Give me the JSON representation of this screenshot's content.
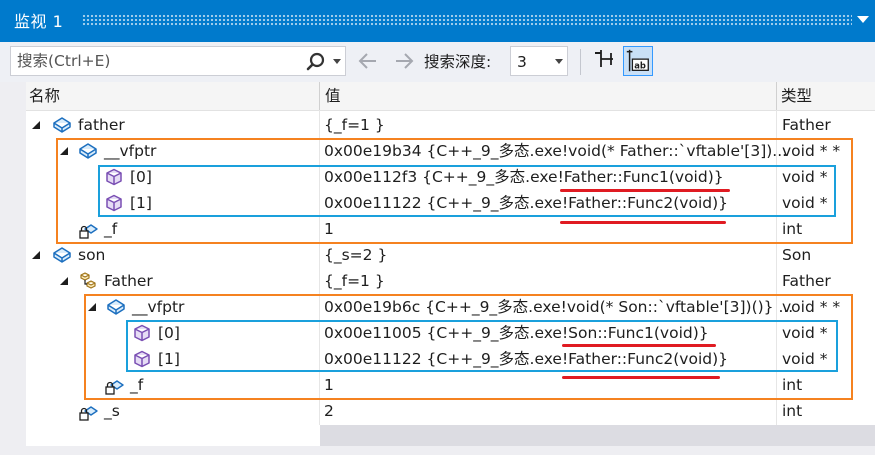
{
  "window": {
    "title": "监视 1"
  },
  "toolbar": {
    "search_placeholder": "搜索(Ctrl+E)",
    "depth_label": "搜索深度:",
    "depth_value": "3"
  },
  "columns": {
    "name": "名称",
    "value": "值",
    "type": "类型"
  },
  "rows": [
    {
      "name": "father",
      "value": "{_f=1 }",
      "type": "Father"
    },
    {
      "name": "__vfptr",
      "value": "0x00e19b34 {C++_9_多态.exe!void(* Father::`vftable'[3])...",
      "type": "void * *"
    },
    {
      "name": "[0]",
      "value": "0x00e112f3 {C++_9_多态.exe!Father::Func1(void)}",
      "type": "void *"
    },
    {
      "name": "[1]",
      "value": "0x00e11122 {C++_9_多态.exe!Father::Func2(void)}",
      "type": "void *"
    },
    {
      "name": "_f",
      "value": "1",
      "type": "int"
    },
    {
      "name": "son",
      "value": "{_s=2 }",
      "type": "Son"
    },
    {
      "name": "Father",
      "value": "{_f=1 }",
      "type": "Father"
    },
    {
      "name": "__vfptr",
      "value": "0x00e19b6c {C++_9_多态.exe!void(* Son::`vftable'[3])()} ...",
      "type": "void * *"
    },
    {
      "name": "[0]",
      "value": "0x00e11005 {C++_9_多态.exe!Son::Func1(void)}",
      "type": "void *"
    },
    {
      "name": "[1]",
      "value": "0x00e11122 {C++_9_多态.exe!Father::Func2(void)}",
      "type": "void *"
    },
    {
      "name": "_f",
      "value": "1",
      "type": "int"
    },
    {
      "name": "_s",
      "value": "2",
      "type": "int"
    }
  ],
  "icons": {
    "object": "cube-outline-blue-icon",
    "vfptr": "field-blue-icon",
    "function_ptr": "cube-purple-icon",
    "field_locked": "locked-field-icon",
    "base_class": "base-class-icon",
    "search": "magnifier-icon",
    "back": "arrow-left-icon",
    "forward": "arrow-right-icon",
    "pin": "pin-icon",
    "hex": "ab-display-icon"
  },
  "colors": {
    "titlebar": "#007acc",
    "annotation_orange": "#f58220",
    "annotation_blue": "#1aa0dc",
    "annotation_red": "#e01b22"
  }
}
